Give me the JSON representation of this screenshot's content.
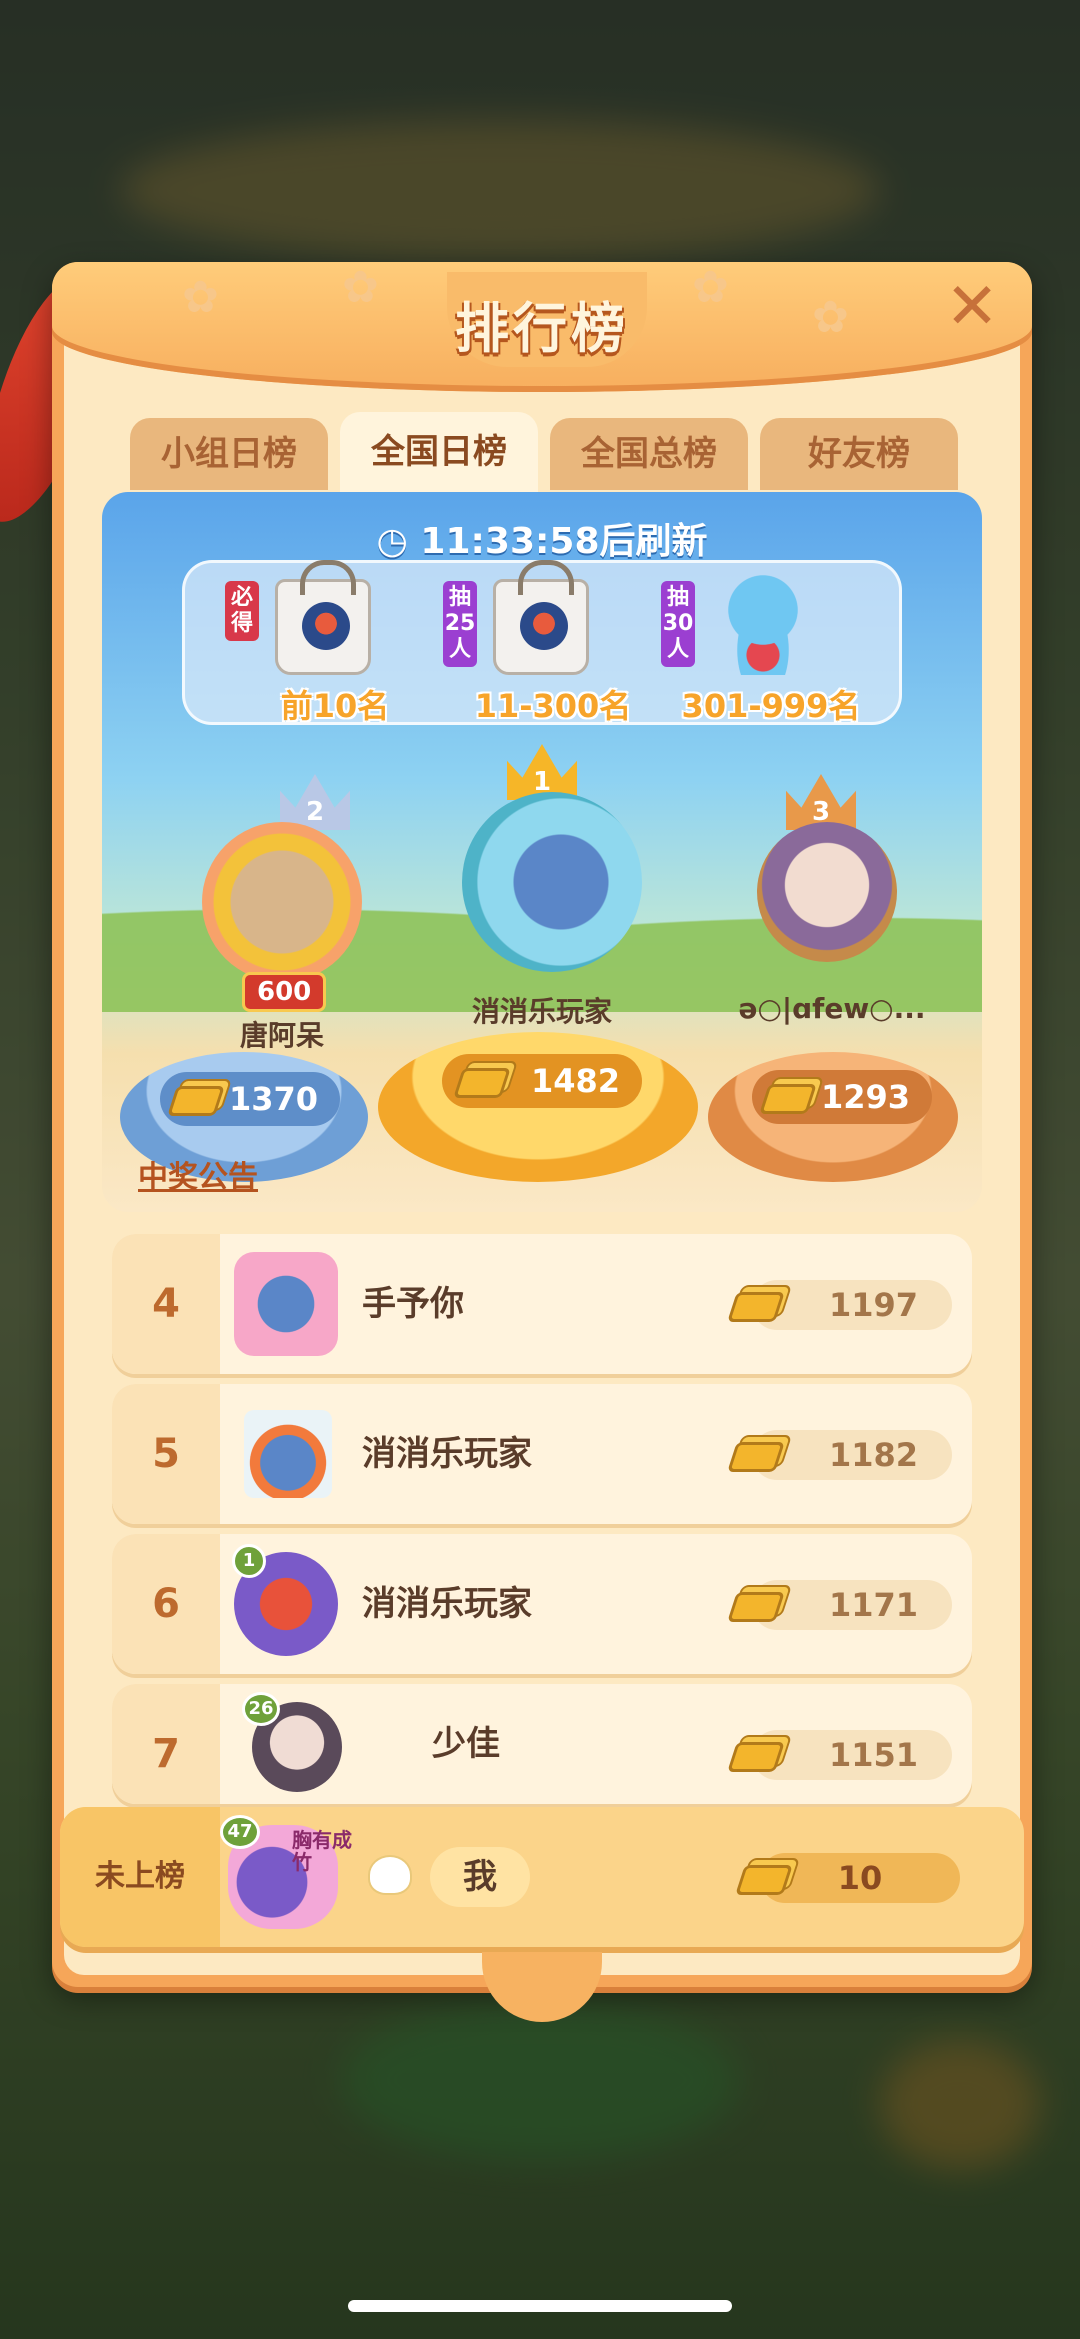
{
  "panel": {
    "title": "排行榜"
  },
  "tabs": [
    {
      "label": "小组日榜",
      "active": false
    },
    {
      "label": "全国日榜",
      "active": true
    },
    {
      "label": "全国总榜",
      "active": false
    },
    {
      "label": "好友榜",
      "active": false
    }
  ],
  "timer": {
    "text": "11:33:58后刷新"
  },
  "prizes": [
    {
      "tag": "必得",
      "label": "前10名",
      "icon": "tote-bag-icon"
    },
    {
      "tag": "抽25人",
      "label": "11-300名",
      "icon": "tote-bag-icon"
    },
    {
      "tag": "抽30人",
      "label": "301-999名",
      "icon": "blue-bear-plush-icon"
    }
  ],
  "podium": [
    {
      "rank": "2",
      "name": "唐阿呆",
      "score": "1370",
      "badge": "600"
    },
    {
      "rank": "1",
      "name": "消消乐玩家",
      "score": "1482"
    },
    {
      "rank": "3",
      "name": "ə○|ɑfew○...",
      "score": "1293"
    }
  ],
  "notice_label": "中奖公告",
  "rows": [
    {
      "rank": "4",
      "name": "手予你",
      "score": "1197"
    },
    {
      "rank": "5",
      "name": "消消乐玩家",
      "score": "1182"
    },
    {
      "rank": "6",
      "name": "消消乐玩家",
      "score": "1171",
      "level": "1"
    },
    {
      "rank": "7",
      "name": "少佳",
      "score": "1151",
      "level": "26"
    }
  ],
  "me": {
    "rank_label": "未上榜",
    "name": "我",
    "score": "10",
    "level": "47",
    "avatar_text": "胸有成竹"
  },
  "colors": {
    "panel": "#f6a659",
    "title": "#fff5dd",
    "accent": "#bd6a2e",
    "gold": "#f3b52c"
  }
}
